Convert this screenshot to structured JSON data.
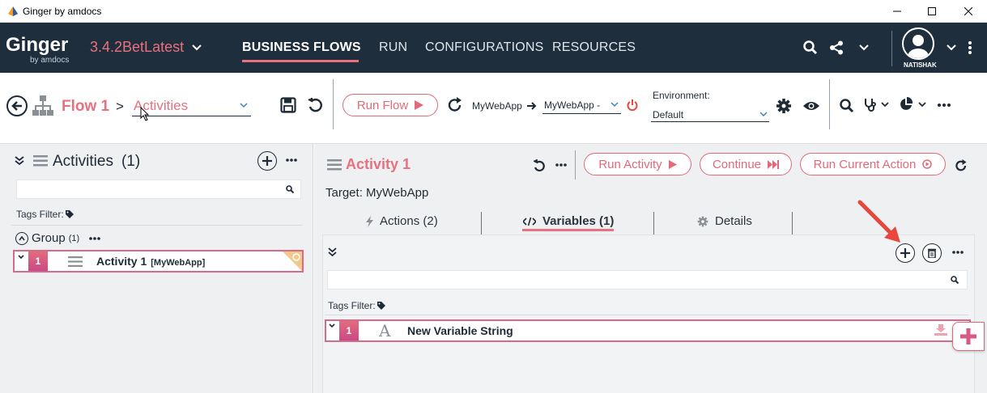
{
  "window": {
    "title": "Ginger by amdocs"
  },
  "nav": {
    "logo": "Ginger",
    "logo_sub": "by amdocs",
    "version": "3.4.2BetLatest",
    "tabs": [
      "BUSINESS FLOWS",
      "RUN",
      "CONFIGURATIONS",
      "RESOURCES"
    ],
    "active_tab_index": 0,
    "user": "NATISHAK"
  },
  "toolbar": {
    "flow_name": "Flow 1",
    "breadcrumb_sep": ">",
    "view_select": "Activities",
    "run_flow_label": "Run Flow",
    "app_label": "MyWebApp",
    "app_target": "MyWebApp -",
    "environment_label": "Environment:",
    "environment_value": "Default"
  },
  "left": {
    "title": "Activities",
    "count": "(1)",
    "tags_filter": "Tags Filter:",
    "group_label": "Group",
    "group_count": "(1)",
    "activity": {
      "num": "1",
      "name": "Activity 1",
      "target": "[MyWebApp]"
    }
  },
  "right": {
    "title": "Activity 1",
    "target_line": "Target: MyWebApp",
    "run_activity_label": "Run Activity",
    "continue_label": "Continue",
    "run_current_action_label": "Run Current Action",
    "tabs": [
      {
        "label": "Actions (2)",
        "icon": "bolt-icon"
      },
      {
        "label": "Variables (1)",
        "icon": "code-icon"
      },
      {
        "label": "Details",
        "icon": "gear-icon"
      }
    ],
    "active_tab_index": 1,
    "tags_filter": "Tags Filter:",
    "variable": {
      "num": "1",
      "type_glyph": "A",
      "name": "New Variable String"
    }
  },
  "colors": {
    "accent": "#e06a7a",
    "nav_bg": "#1f2e3d",
    "arrow": "#e8473c"
  }
}
